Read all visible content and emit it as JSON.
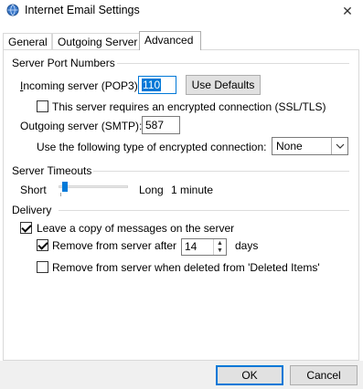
{
  "window": {
    "title": "Internet Email Settings",
    "close_glyph": "✕",
    "icon": "globe-mail-icon"
  },
  "tabs": [
    {
      "label": "General"
    },
    {
      "label": "Outgoing Server"
    },
    {
      "label": "Advanced",
      "active": true
    }
  ],
  "server_ports": {
    "group_label": "Server Port Numbers",
    "incoming_label": "Incoming server (POP3):",
    "incoming_value": "110",
    "use_defaults_label": "Use Defaults",
    "ssl_checkbox_label": "This server requires an encrypted connection (SSL/TLS)",
    "ssl_checked": false,
    "outgoing_label": "Outgoing server (SMTP):",
    "outgoing_value": "587",
    "encryption_label": "Use the following type of encrypted connection:",
    "encryption_value": "None"
  },
  "timeouts": {
    "group_label": "Server Timeouts",
    "short_label": "Short",
    "long_label": "Long",
    "value_label": "1 minute",
    "slider_level": 0.05
  },
  "delivery": {
    "group_label": "Delivery",
    "leave_copy_label": "Leave a copy of messages on the server",
    "leave_copy_checked": true,
    "remove_after_label": "Remove from server after",
    "remove_after_checked": true,
    "remove_after_days": "14",
    "days_label": "days",
    "remove_deleted_label": "Remove from server when deleted from 'Deleted Items'",
    "remove_deleted_checked": false
  },
  "footer": {
    "ok_label": "OK",
    "cancel_label": "Cancel"
  },
  "colors": {
    "accent": "#0078d7",
    "selection": "#0078d7",
    "slider_thumb": "#007ad9"
  }
}
